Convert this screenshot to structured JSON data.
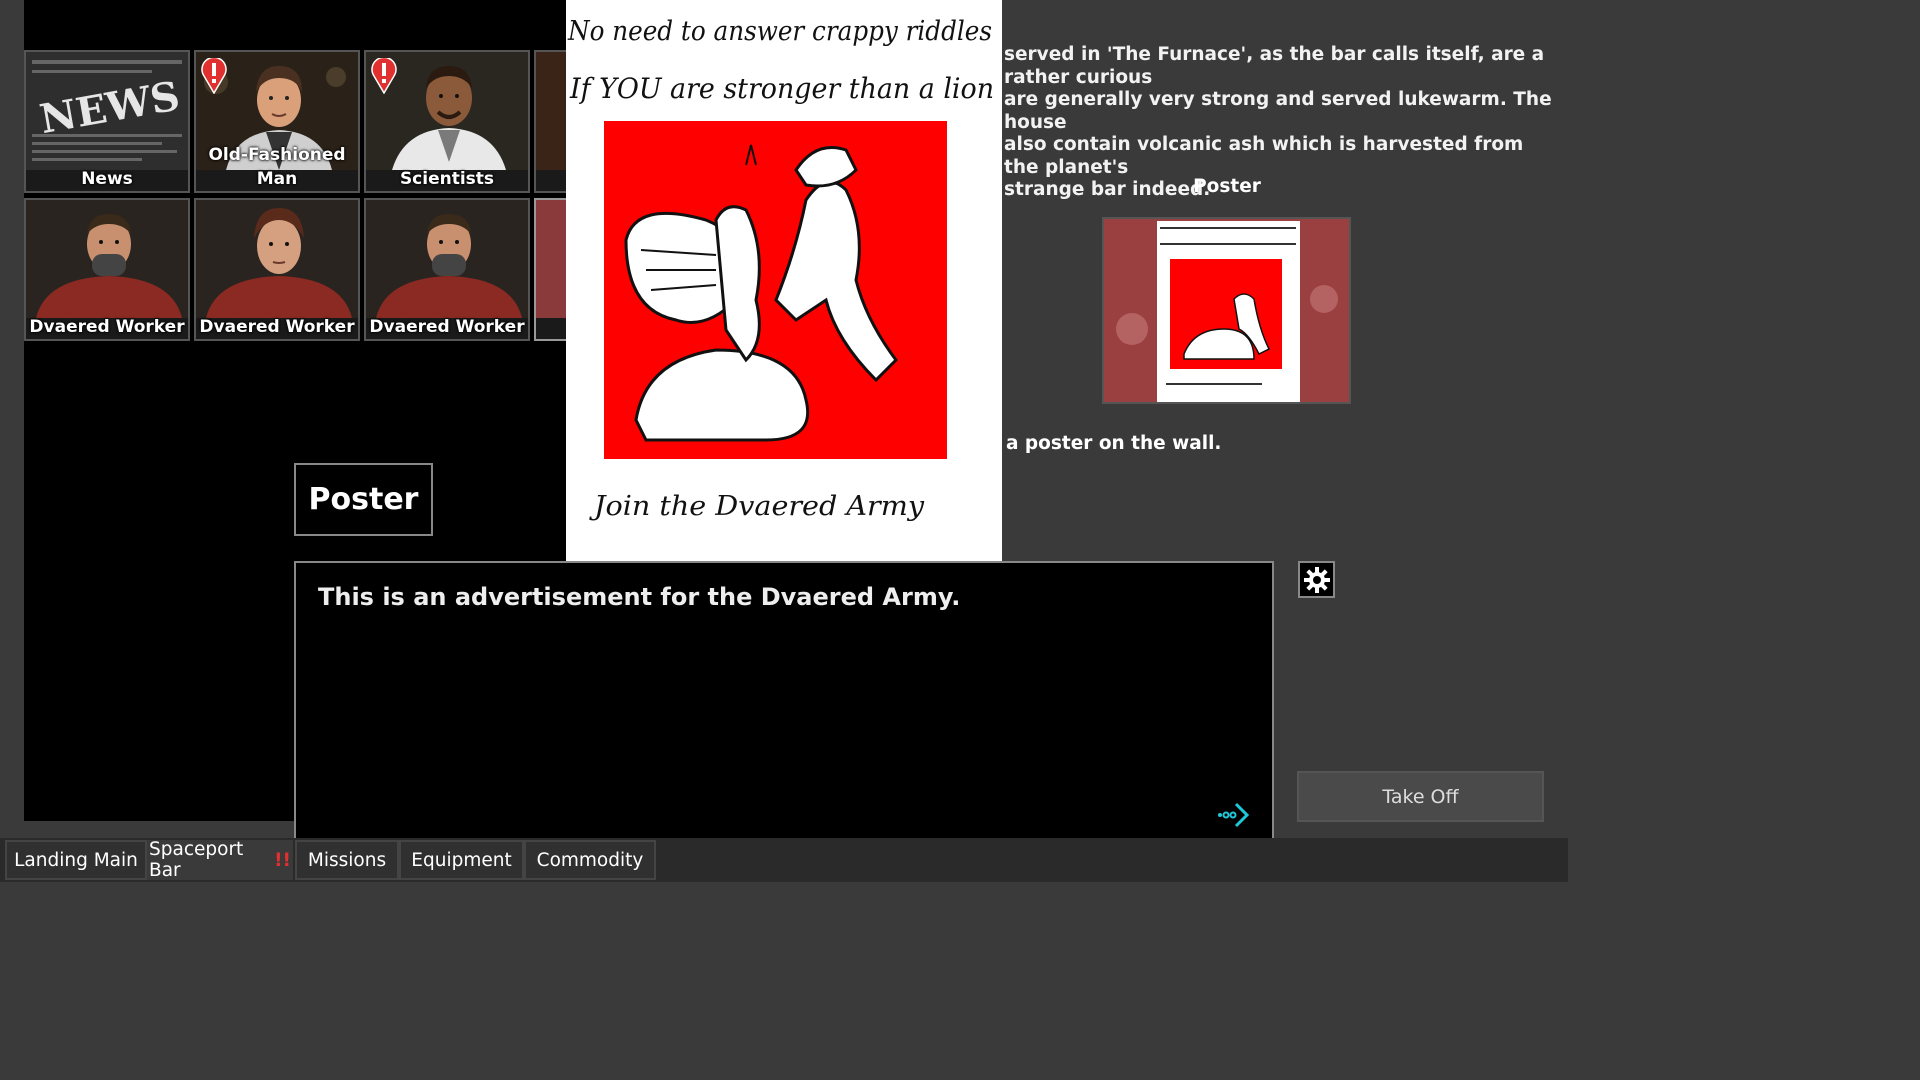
{
  "npcs": [
    {
      "label": "News",
      "alert": false
    },
    {
      "label": "Old-Fashioned Man",
      "alert": true
    },
    {
      "label": "Scientists",
      "alert": true
    },
    {
      "label": "Dvaered Worker",
      "alert": false
    },
    {
      "label": "Dvaered Worker",
      "alert": false
    },
    {
      "label": "Dvaered Worker",
      "alert": false
    }
  ],
  "poster_title": "Poster",
  "poster": {
    "line1": "No need to answer crappy riddles",
    "line2": "If YOU are stronger than a lion",
    "footer": "Join the Dvaered Army"
  },
  "dialog": {
    "text": "This is an advertisement for the Dvaered Army."
  },
  "description": "served in 'The Furnace', as the bar calls itself, are a rather curious\nare generally very strong and served lukewarm. The house\nalso contain volcanic ash which is harvested from the planet's\nstrange bar indeed.",
  "right_poster_label": "Poster",
  "right_caption": "a poster on the wall.",
  "takeoff_label": "Take Off",
  "tabs": [
    {
      "label": "Landing Main",
      "alert": ""
    },
    {
      "label": "Spaceport Bar",
      "alert": "!!"
    },
    {
      "label": "Missions",
      "alert": ""
    },
    {
      "label": "Equipment",
      "alert": ""
    },
    {
      "label": "Commodity",
      "alert": ""
    }
  ],
  "colors": {
    "poster_red": "#ff0000",
    "alert_red": "#e03030",
    "arrow_cyan": "#1ec8d8"
  }
}
